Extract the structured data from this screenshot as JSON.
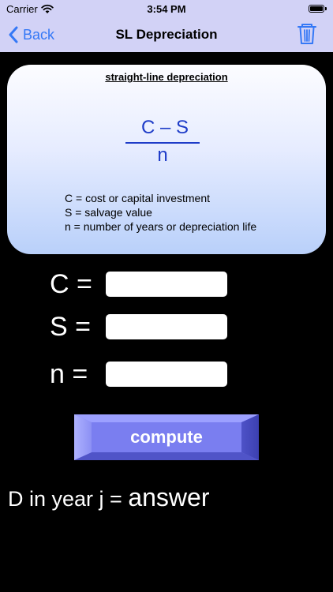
{
  "status_bar": {
    "carrier": "Carrier",
    "time": "3:54 PM",
    "wifi_icon": "wifi-icon",
    "battery_icon": "battery-icon"
  },
  "nav": {
    "back_label": "Back",
    "title": "SL Depreciation",
    "back_icon": "chevron-left-icon",
    "trash_icon": "trash-icon",
    "accent_color": "#3478f6",
    "bar_color": "#d2d2f6"
  },
  "formula_card": {
    "heading": "straight-line depreciation",
    "numerator": "C – S",
    "denominator": "n",
    "definitions": [
      "C = cost or capital investment",
      "S = salvage value",
      "n = number of years or depreciation life"
    ],
    "formula_color": "#1e3cc8"
  },
  "inputs": [
    {
      "label": "C =",
      "value": "",
      "placeholder": ""
    },
    {
      "label": "S =",
      "value": "",
      "placeholder": ""
    },
    {
      "label": "n =",
      "value": "",
      "placeholder": ""
    }
  ],
  "compute_button": {
    "label": "compute",
    "color": "#7a7ef0"
  },
  "result": {
    "prefix": "D in year j = ",
    "value": "answer"
  }
}
